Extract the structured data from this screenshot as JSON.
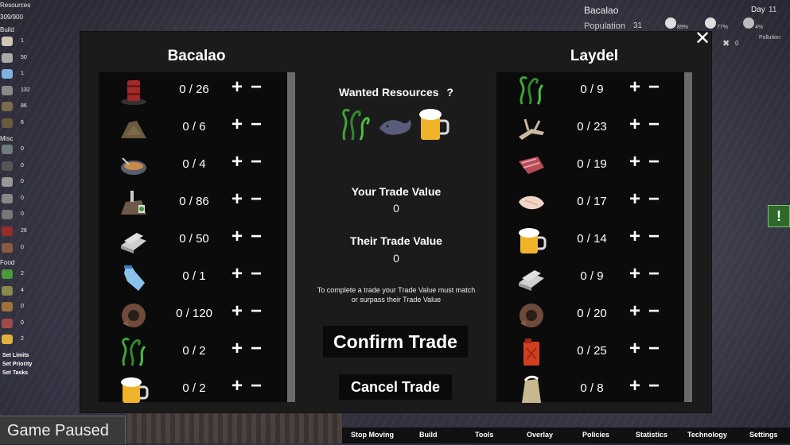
{
  "sidebar": {
    "title": "Resources",
    "capacity": "309/900",
    "section_build": "Build",
    "section_misc": "Misc",
    "section_food": "Food",
    "build_items": [
      {
        "icon": "lumber-icon",
        "count": "1",
        "color": "#cfc7b4"
      },
      {
        "icon": "stone-icon",
        "count": "50",
        "color": "#aaa9a5"
      },
      {
        "icon": "plastic-bottle-icon",
        "count": "1",
        "color": "#7fb2e0"
      },
      {
        "icon": "scrap-metal-icon",
        "count": "132",
        "color": "#8a8a8a"
      },
      {
        "icon": "sand-icon",
        "count": "86",
        "color": "#7d6a4c"
      },
      {
        "icon": "dirt-icon",
        "count": "6",
        "color": "#6b5a3c"
      }
    ],
    "misc_items": [
      {
        "icon": "trash-icon",
        "count": "0",
        "color": "#6e7c7d"
      },
      {
        "icon": "tire-icon",
        "count": "0",
        "color": "#555"
      },
      {
        "icon": "rope-icon",
        "count": "0",
        "color": "#999"
      },
      {
        "icon": "fish-bone-icon",
        "count": "0",
        "color": "#888"
      },
      {
        "icon": "rock-icon",
        "count": "0",
        "color": "#777"
      },
      {
        "icon": "barrel-icon",
        "count": "26",
        "color": "#9a2b2b"
      },
      {
        "icon": "fabric-icon",
        "count": "0",
        "color": "#8a5a40"
      }
    ],
    "food_items": [
      {
        "icon": "seaweed-icon",
        "count": "2",
        "color": "#4a9a3a"
      },
      {
        "icon": "fish-icon",
        "count": "4",
        "color": "#8a8a4a"
      },
      {
        "icon": "bread-icon",
        "count": "0",
        "color": "#a0703a"
      },
      {
        "icon": "meat-icon",
        "count": "0",
        "color": "#a04a4a"
      },
      {
        "icon": "beer-icon",
        "count": "2",
        "color": "#e0b040"
      }
    ],
    "links": [
      "Set Limits",
      "Set Priority",
      "Set Tasks"
    ]
  },
  "hud": {
    "town": "Bacalao",
    "population_label": "Population",
    "population_value": "31",
    "day_label": "Day",
    "day_value": "11",
    "stats": [
      {
        "icon": "person-icon",
        "value": "89%"
      },
      {
        "icon": "worker-icon",
        "value": "77%"
      },
      {
        "icon": "pollution-icon",
        "value": "4%"
      }
    ],
    "zero_count": "0",
    "pollution_label": "Pollution"
  },
  "trade": {
    "left_title": "Bacalao",
    "right_title": "Laydel",
    "left_items": [
      {
        "icon": "barrel-icon",
        "qty": "0 / 26"
      },
      {
        "icon": "dirt-pile-icon",
        "qty": "0 / 6"
      },
      {
        "icon": "fish-bowl-icon",
        "qty": "0 / 4"
      },
      {
        "icon": "junk-pile-icon",
        "qty": "0 / 86"
      },
      {
        "icon": "scrap-metal-icon",
        "qty": "0 / 50"
      },
      {
        "icon": "plastic-bottle-icon",
        "qty": "0 / 1"
      },
      {
        "icon": "rust-scrap-icon",
        "qty": "0 / 120"
      },
      {
        "icon": "seaweed-icon",
        "qty": "0 / 2"
      },
      {
        "icon": "beer-icon",
        "qty": "0 / 2"
      }
    ],
    "right_items": [
      {
        "icon": "seaweed-icon",
        "qty": "0 / 9"
      },
      {
        "icon": "driftwood-icon",
        "qty": "0 / 23"
      },
      {
        "icon": "raw-meat-icon",
        "qty": "0 / 19"
      },
      {
        "icon": "fish-fillet-icon",
        "qty": "0 / 17"
      },
      {
        "icon": "beer-icon",
        "qty": "0 / 14"
      },
      {
        "icon": "scrap-metal-icon",
        "qty": "0 / 9"
      },
      {
        "icon": "rust-scrap-icon",
        "qty": "0 / 20"
      },
      {
        "icon": "fuel-can-icon",
        "qty": "0 / 25"
      },
      {
        "icon": "sand-bag-icon",
        "qty": "0 / 8"
      }
    ],
    "plus": "+",
    "minus": "−",
    "wanted_title": "Wanted Resources",
    "help": "?",
    "wanted_icons": [
      "seaweed-icon",
      "whale-icon",
      "beer-icon"
    ],
    "your_value_label": "Your Trade Value",
    "your_value": "0",
    "their_value_label": "Their Trade Value",
    "their_value": "0",
    "hint": "To complete a trade your Trade Value must match or surpass their Trade Value",
    "confirm_label": "Confirm Trade",
    "cancel_label": "Cancel Trade",
    "close": "✕"
  },
  "bottom": {
    "status": "Game Paused",
    "tabs": [
      "Stop Moving",
      "Build",
      "Tools",
      "Overlay",
      "Policies",
      "Statistics",
      "Technology",
      "Settings"
    ]
  }
}
